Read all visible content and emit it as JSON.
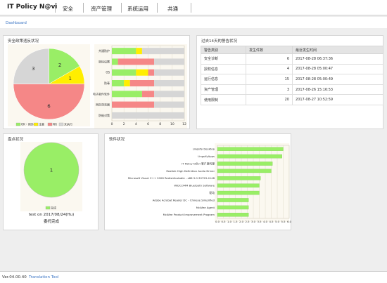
{
  "app": {
    "title": "IT Policy N@vi"
  },
  "nav": {
    "items": [
      "安全",
      "资产管理",
      "系统运用",
      "共通"
    ]
  },
  "breadcrumb": {
    "label": "Dashboard"
  },
  "colors": {
    "green": "#99ee66",
    "yellow": "#ffee00",
    "red": "#f58787",
    "gray": "#d6d6d6",
    "link": "#3a74c4"
  },
  "security_panel": {
    "title": "安全政策违反状况"
  },
  "alerts_panel": {
    "title": "过去14天的警告状况",
    "columns": [
      "警告类别",
      "发生件数",
      "最近发生时间"
    ],
    "rows": [
      {
        "category": "安全诊断",
        "count": "6",
        "last": "2017-08-28 06:37:36"
      },
      {
        "category": "授权信息",
        "count": "4",
        "last": "2017-08-28 05:00:47"
      },
      {
        "category": "运行信息",
        "count": "15",
        "last": "2017-08-28 05:00:49"
      },
      {
        "category": "资产管理",
        "count": "3",
        "last": "2017-08-26 15:16:53"
      },
      {
        "category": "使用限制",
        "count": "20",
        "last": "2017-08-27 10:52:59"
      }
    ]
  },
  "inventory_panel": {
    "title": "盘点状况",
    "caption1": "test on 2017/08/24(Hu)",
    "caption2": "委托完成"
  },
  "software_panel": {
    "title": "软件状况"
  },
  "footer": {
    "version": "Ver.04.00.40",
    "tool_label": "Translation Tool"
  },
  "chart_data": [
    {
      "type": "pie",
      "categories": [
        "OK・例外",
        "注意",
        "NG",
        "未执行"
      ],
      "colors": [
        "#99ee66",
        "#ffee00",
        "#f58787",
        "#d6d6d6"
      ],
      "values": [
        2,
        1,
        6,
        3
      ],
      "legend": "bottom"
    },
    {
      "type": "bar",
      "orientation": "horizontal",
      "stacked": true,
      "categories": [
        "共通防护",
        "密码设置",
        "OS",
        "防毒",
        "电子邮件软件",
        "网页浏览器",
        "防偷对策"
      ],
      "series": [
        {
          "name": "OK・例外",
          "color": "#99ee66",
          "values": [
            4,
            1,
            4,
            2,
            5,
            0,
            0
          ]
        },
        {
          "name": "注意",
          "color": "#ffee00",
          "values": [
            1,
            0,
            2,
            1,
            0,
            0,
            0
          ]
        },
        {
          "name": "NG",
          "color": "#f58787",
          "values": [
            0,
            6,
            1,
            4,
            2,
            7,
            0
          ]
        },
        {
          "name": "未执行",
          "color": "#d6d6d6",
          "values": [
            7,
            5,
            5,
            5,
            5,
            5,
            12
          ]
        }
      ],
      "xlim": [
        0,
        12
      ],
      "xticks": [
        0,
        2,
        4,
        6,
        8,
        10,
        12
      ],
      "grid": true
    },
    {
      "type": "pie",
      "categories": [
        "完成"
      ],
      "colors": [
        "#99ee66"
      ],
      "values": [
        1
      ],
      "legend": "bottom"
    },
    {
      "type": "bar",
      "orientation": "horizontal",
      "categories": [
        "Lingsify Desktop",
        "LingsifyApps",
        "IT Policy N@vi 客户端代理",
        "Realtek High Definition Audio Driver",
        "Microsoft Visual C++ 2008 Redistributable - x86 9.0.30729.4148",
        "WIDCOMM Bluetooth Software",
        "驱动",
        "Adobe Acrobat Reader DC - Chinese Simplified",
        "McAfee Agent",
        "McAfee Product Improvement Program"
      ],
      "values": [
        5.5,
        5.4,
        4.6,
        4.5,
        3.6,
        3.5,
        3.5,
        2.6,
        2.6,
        2.6
      ],
      "color": "#99ee66",
      "xlim": [
        0,
        5.5
      ],
      "xticks": [
        "0.0",
        "0.5",
        "1.0",
        "1.5",
        "2.0",
        "2.5",
        "3.0",
        "3.5",
        "4.0",
        "4.5",
        "5.0",
        "5.5",
        "6.0"
      ],
      "grid": true
    }
  ]
}
